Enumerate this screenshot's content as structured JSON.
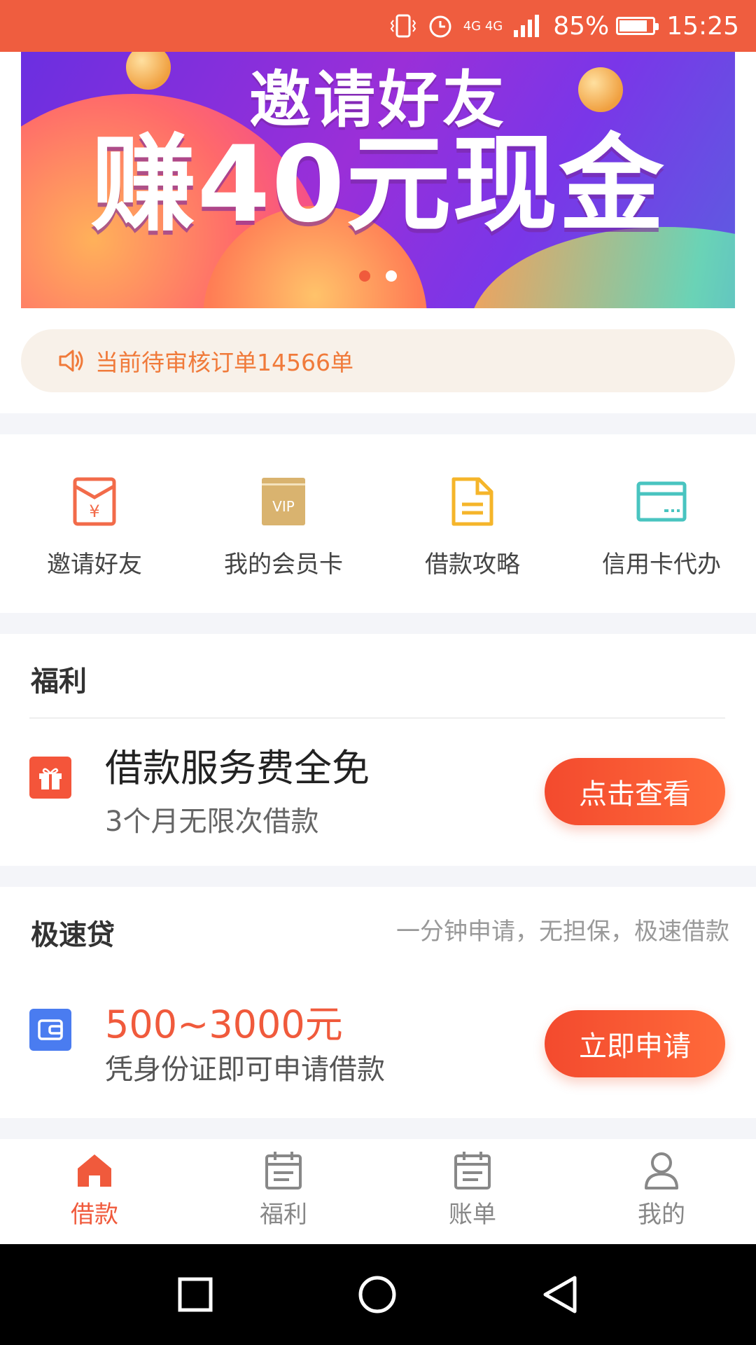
{
  "status_bar": {
    "network": "4G 4G",
    "battery": "85%",
    "battery_level": 0.85,
    "time": "15:25",
    "icons": [
      "vibrate-icon",
      "alarm-icon",
      "signal-icon",
      "battery-icon"
    ]
  },
  "banner": {
    "line1": "邀请好友",
    "line2": "赚40元现金",
    "active_slide": 1,
    "slide_count": 2
  },
  "notice": {
    "icon": "speaker-icon",
    "text": "当前待审核订单14566单"
  },
  "quick_menu": [
    {
      "label": "邀请好友",
      "icon": "red-envelope-icon",
      "color": "#f26b4a"
    },
    {
      "label": "我的会员卡",
      "icon": "vip-card-icon",
      "color": "#d9b36f"
    },
    {
      "label": "借款攻略",
      "icon": "document-icon",
      "color": "#f5b52a"
    },
    {
      "label": "信用卡代办",
      "icon": "credit-card-icon",
      "color": "#49c4c0"
    }
  ],
  "welfare": {
    "title": "福利",
    "headline": "借款服务费全免",
    "sub": "3个月无限次借款",
    "button": "点击查看",
    "icon": "gift-icon"
  },
  "express_loan": {
    "title": "极速贷",
    "tagline": "一分钟申请，无担保，极速借款",
    "amount": "500~3000元",
    "sub": "凭身份证即可申请借款",
    "button": "立即申请",
    "icon": "wallet-icon"
  },
  "bottom_nav": [
    {
      "label": "借款",
      "icon": "home-icon",
      "active": true
    },
    {
      "label": "福利",
      "icon": "calendar-icon",
      "active": false
    },
    {
      "label": "账单",
      "icon": "bill-icon",
      "active": false
    },
    {
      "label": "我的",
      "icon": "user-icon",
      "active": false
    }
  ],
  "system_nav": [
    "recents-icon",
    "home-circle-icon",
    "back-icon"
  ],
  "colors": {
    "accent": "#f05a3c",
    "status_bar": "#ef5d3f",
    "notice_bg": "#f8f1e9",
    "amount": "#f05a3c"
  }
}
